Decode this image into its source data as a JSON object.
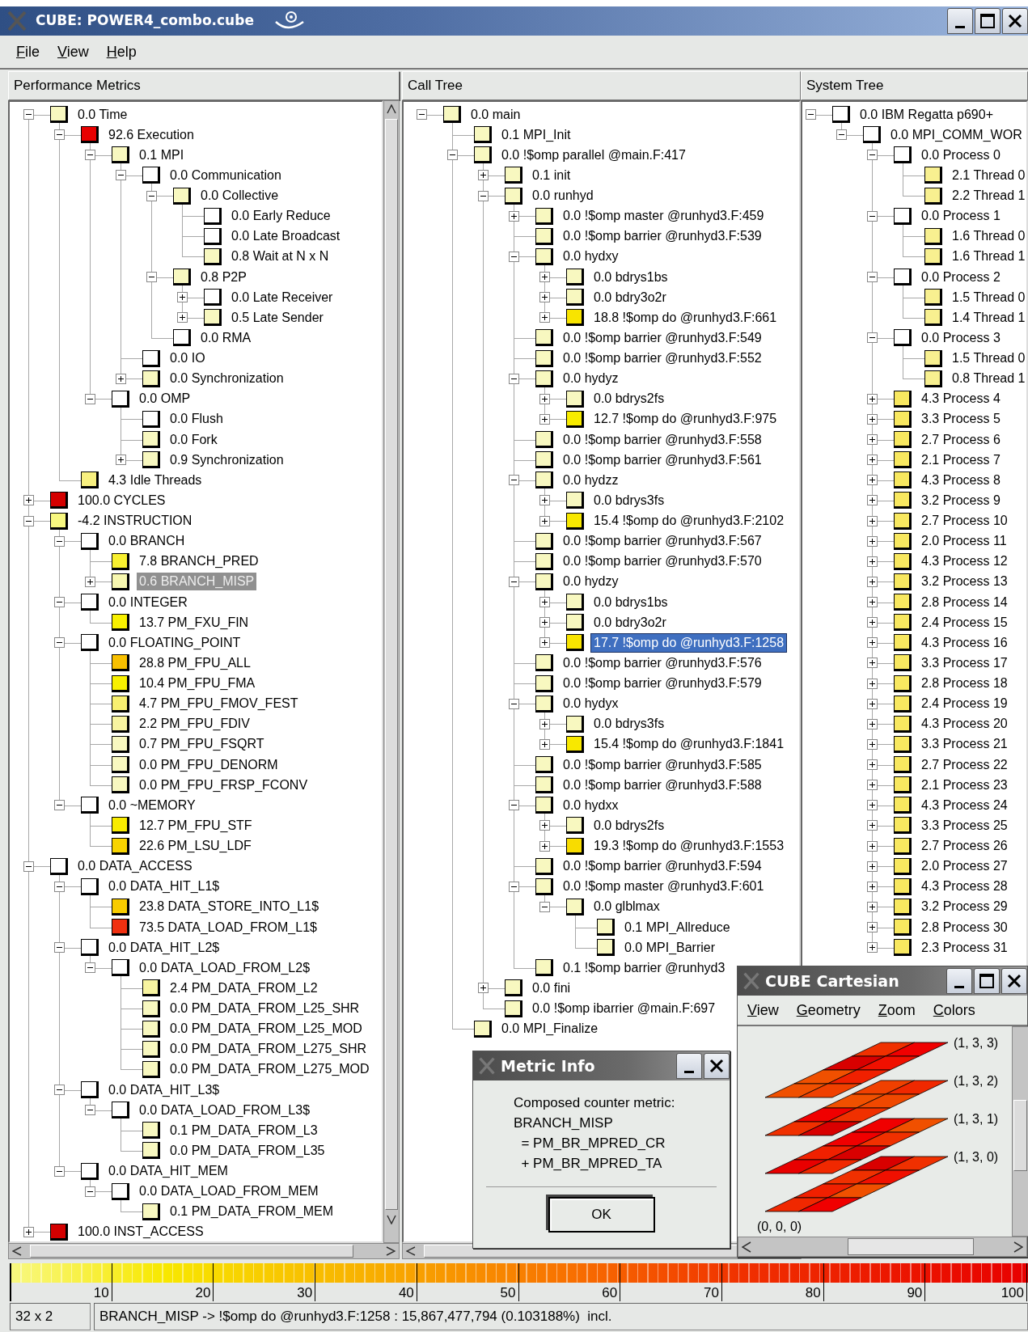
{
  "window": {
    "title": "CUBE: POWER4_combo.cube"
  },
  "menu": [
    "File",
    "View",
    "Help"
  ],
  "panels": [
    {
      "title": "Performance Metrics",
      "tree": [
        {
          "label": "0.0 Time",
          "color": "#f8f8c0",
          "selected": false,
          "expanded": true,
          "children": [
            {
              "label": "92.6 Execution",
              "color": "#e80000",
              "selected": false,
              "expanded": true,
              "children": [
                {
                  "label": "0.1 MPI",
                  "color": "#f8f8c0",
                  "selected": false,
                  "expanded": true,
                  "children": [
                    {
                      "label": "0.0 Communication",
                      "color": "#ffffff",
                      "selected": false,
                      "expanded": true,
                      "children": [
                        {
                          "label": "0.0 Collective",
                          "color": "#f8f8c0",
                          "selected": false,
                          "expanded": true,
                          "children": [
                            {
                              "label": "0.0 Early Reduce",
                              "color": "#ffffff",
                              "selected": false
                            },
                            {
                              "label": "0.0 Late Broadcast",
                              "color": "#ffffff",
                              "selected": false
                            },
                            {
                              "label": "0.8 Wait at N x N",
                              "color": "#f8f8c0",
                              "selected": false
                            }
                          ]
                        },
                        {
                          "label": "0.8 P2P",
                          "color": "#f8f8c0",
                          "selected": false,
                          "expanded": true,
                          "children": [
                            {
                              "label": "0.0 Late Receiver",
                              "color": "#ffffff",
                              "selected": false,
                              "expanded": false
                            },
                            {
                              "label": "0.5 Late Sender",
                              "color": "#f8f8c0",
                              "selected": false,
                              "expanded": false
                            }
                          ]
                        },
                        {
                          "label": "0.0 RMA",
                          "color": "#ffffff",
                          "selected": false
                        }
                      ]
                    },
                    {
                      "label": "0.0 IO",
                      "color": "#ffffff",
                      "selected": false
                    },
                    {
                      "label": "0.0 Synchronization",
                      "color": "#f8f8c0",
                      "selected": false,
                      "expanded": false
                    }
                  ]
                },
                {
                  "label": "0.0 OMP",
                  "color": "#ffffff",
                  "selected": false,
                  "expanded": true,
                  "children": [
                    {
                      "label": "0.0 Flush",
                      "color": "#ffffff",
                      "selected": false
                    },
                    {
                      "label": "0.0 Fork",
                      "color": "#f8f8c0",
                      "selected": false
                    },
                    {
                      "label": "0.9 Synchronization",
                      "color": "#f8f8c0",
                      "selected": false,
                      "expanded": false
                    }
                  ]
                }
              ]
            },
            {
              "label": "4.3 Idle Threads",
              "color": "#f8f080",
              "selected": false
            }
          ]
        },
        {
          "label": "100.0 CYCLES",
          "color": "#d40000",
          "selected": false,
          "expanded": false
        },
        {
          "label": "-4.2 INSTRUCTION",
          "color": "#f8f880",
          "selected": false,
          "expanded": true,
          "children": [
            {
              "label": "0.0 BRANCH",
              "color": "#ffffff",
              "selected": false,
              "expanded": true,
              "children": [
                {
                  "label": "7.8 BRANCH_PRED",
                  "color": "#f8f030",
                  "selected": false
                },
                {
                  "label": "0.6 BRANCH_MISP",
                  "color": "#f8f8b0",
                  "selected": true,
                  "expanded": false
                }
              ]
            },
            {
              "label": "0.0 INTEGER",
              "color": "#ffffff",
              "selected": false,
              "expanded": true,
              "children": [
                {
                  "label": "13.7 PM_FXU_FIN",
                  "color": "#f8f000",
                  "selected": false
                }
              ]
            },
            {
              "label": "0.0 FLOATING_POINT",
              "color": "#ffffff",
              "selected": false,
              "expanded": true,
              "children": [
                {
                  "label": "28.8 PM_FPU_ALL",
                  "color": "#f8c000",
                  "selected": false
                },
                {
                  "label": "10.4 PM_FPU_FMA",
                  "color": "#f8f000",
                  "selected": false
                },
                {
                  "label": "4.7 PM_FPU_FMOV_FEST",
                  "color": "#f8f070",
                  "selected": false
                },
                {
                  "label": "2.2 PM_FPU_FDIV",
                  "color": "#f8f4a0",
                  "selected": false
                },
                {
                  "label": "0.7 PM_FPU_FSQRT",
                  "color": "#f8f8c0",
                  "selected": false
                },
                {
                  "label": "0.0 PM_FPU_DENORM",
                  "color": "#f8f8c0",
                  "selected": false
                },
                {
                  "label": "0.0 PM_FPU_FRSP_FCONV",
                  "color": "#f8f8c0",
                  "selected": false
                }
              ]
            },
            {
              "label": "0.0 ~MEMORY",
              "color": "#ffffff",
              "selected": false,
              "expanded": true,
              "children": [
                {
                  "label": "12.7 PM_FPU_STF",
                  "color": "#f8ec00",
                  "selected": false
                },
                {
                  "label": "22.6 PM_LSU_LDF",
                  "color": "#f8d400",
                  "selected": false
                }
              ]
            }
          ]
        },
        {
          "label": "0.0 DATA_ACCESS",
          "color": "#ffffff",
          "selected": false,
          "expanded": true,
          "children": [
            {
              "label": "0.0 DATA_HIT_L1$",
              "color": "#ffffff",
              "selected": false,
              "expanded": true,
              "children": [
                {
                  "label": "23.8 DATA_STORE_INTO_L1$",
                  "color": "#f8cc00",
                  "selected": false
                },
                {
                  "label": "73.5 DATA_LOAD_FROM_L1$",
                  "color": "#f03010",
                  "selected": false
                }
              ]
            },
            {
              "label": "0.0 DATA_HIT_L2$",
              "color": "#ffffff",
              "selected": false,
              "expanded": true,
              "children": [
                {
                  "label": "0.0 DATA_LOAD_FROM_L2$",
                  "color": "#ffffff",
                  "selected": false,
                  "expanded": true,
                  "children": [
                    {
                      "label": "2.4 PM_DATA_FROM_L2",
                      "color": "#f8f4a0",
                      "selected": false
                    },
                    {
                      "label": "0.0 PM_DATA_FROM_L25_SHR",
                      "color": "#f8f8c0",
                      "selected": false
                    },
                    {
                      "label": "0.0 PM_DATA_FROM_L25_MOD",
                      "color": "#f8f8c0",
                      "selected": false
                    },
                    {
                      "label": "0.0 PM_DATA_FROM_L275_SHR",
                      "color": "#f8f8c0",
                      "selected": false
                    },
                    {
                      "label": "0.0 PM_DATA_FROM_L275_MOD",
                      "color": "#f8f8c0",
                      "selected": false
                    }
                  ]
                }
              ]
            },
            {
              "label": "0.0 DATA_HIT_L3$",
              "color": "#ffffff",
              "selected": false,
              "expanded": true,
              "children": [
                {
                  "label": "0.0 DATA_LOAD_FROM_L3$",
                  "color": "#ffffff",
                  "selected": false,
                  "expanded": true,
                  "children": [
                    {
                      "label": "0.1 PM_DATA_FROM_L3",
                      "color": "#f8f8c0",
                      "selected": false
                    },
                    {
                      "label": "0.0 PM_DATA_FROM_L35",
                      "color": "#f8f8c0",
                      "selected": false
                    }
                  ]
                }
              ]
            },
            {
              "label": "0.0 DATA_HIT_MEM",
              "color": "#ffffff",
              "selected": false,
              "expanded": true,
              "children": [
                {
                  "label": "0.0 DATA_LOAD_FROM_MEM",
                  "color": "#ffffff",
                  "selected": false,
                  "expanded": true,
                  "children": [
                    {
                      "label": "0.1 PM_DATA_FROM_MEM",
                      "color": "#f8f8c0",
                      "selected": false
                    }
                  ]
                }
              ]
            }
          ]
        },
        {
          "label": "100.0 INST_ACCESS",
          "color": "#d40000",
          "selected": false,
          "expanded": false
        }
      ]
    },
    {
      "title": "Call Tree",
      "tree": [
        {
          "label": "0.0 main",
          "color": "#f8f8c0",
          "selected": false,
          "expanded": true,
          "children": [
            {
              "label": "0.1 MPI_Init",
              "color": "#f8f8c0",
              "selected": false
            },
            {
              "label": "0.0 !$omp parallel @main.F:417",
              "color": "#f8f8c0",
              "selected": false,
              "expanded": true,
              "children": [
                {
                  "label": "0.1 init",
                  "color": "#f8f8c0",
                  "selected": false,
                  "expanded": false
                },
                {
                  "label": "0.0 runhyd",
                  "color": "#f8f8c0",
                  "selected": false,
                  "expanded": true,
                  "children": [
                    {
                      "label": "0.0 !$omp master @runhyd3.F:459",
                      "color": "#f8f8c0",
                      "selected": false,
                      "expanded": false
                    },
                    {
                      "label": "0.0 !$omp barrier @runhyd3.F:539",
                      "color": "#f8f8c0",
                      "selected": false
                    },
                    {
                      "label": "0.0 hydxy",
                      "color": "#f8f8c0",
                      "selected": false,
                      "expanded": true,
                      "children": [
                        {
                          "label": "0.0 bdrys1bs",
                          "color": "#f8f8c0",
                          "selected": false,
                          "expanded": false
                        },
                        {
                          "label": "0.0 bdry3o2r",
                          "color": "#f8f8c0",
                          "selected": false,
                          "expanded": false
                        },
                        {
                          "label": "18.8 !$omp do @runhyd3.F:661",
                          "color": "#f8e400",
                          "selected": false,
                          "expanded": false
                        }
                      ]
                    },
                    {
                      "label": "0.0 !$omp barrier @runhyd3.F:549",
                      "color": "#f8f8c0",
                      "selected": false
                    },
                    {
                      "label": "0.0 !$omp barrier @runhyd3.F:552",
                      "color": "#f8f8c0",
                      "selected": false
                    },
                    {
                      "label": "0.0 hydyz",
                      "color": "#f8f8c0",
                      "selected": false,
                      "expanded": true,
                      "children": [
                        {
                          "label": "0.0 bdrys2fs",
                          "color": "#f8f8c0",
                          "selected": false,
                          "expanded": false
                        },
                        {
                          "label": "12.7 !$omp do @runhyd3.F:975",
                          "color": "#f8ec00",
                          "selected": false,
                          "expanded": false
                        }
                      ]
                    },
                    {
                      "label": "0.0 !$omp barrier @runhyd3.F:558",
                      "color": "#f8f8c0",
                      "selected": false
                    },
                    {
                      "label": "0.0 !$omp barrier @runhyd3.F:561",
                      "color": "#f8f8c0",
                      "selected": false
                    },
                    {
                      "label": "0.0 hydzz",
                      "color": "#f8f8c0",
                      "selected": false,
                      "expanded": true,
                      "children": [
                        {
                          "label": "0.0 bdrys3fs",
                          "color": "#f8f8c0",
                          "selected": false,
                          "expanded": false
                        },
                        {
                          "label": "15.4 !$omp do @runhyd3.F:2102",
                          "color": "#f8e800",
                          "selected": false,
                          "expanded": false
                        }
                      ]
                    },
                    {
                      "label": "0.0 !$omp barrier @runhyd3.F:567",
                      "color": "#f8f8c0",
                      "selected": false
                    },
                    {
                      "label": "0.0 !$omp barrier @runhyd3.F:570",
                      "color": "#f8f8c0",
                      "selected": false
                    },
                    {
                      "label": "0.0 hydzy",
                      "color": "#f8f8c0",
                      "selected": false,
                      "expanded": true,
                      "children": [
                        {
                          "label": "0.0 bdrys1bs",
                          "color": "#f8f8c0",
                          "selected": false,
                          "expanded": false
                        },
                        {
                          "label": "0.0 bdry3o2r",
                          "color": "#f8f8c0",
                          "selected": false,
                          "expanded": false
                        },
                        {
                          "label": "17.7 !$omp do @runhyd3.F:1258",
                          "color": "#f8e400",
                          "selected": true,
                          "expanded": false
                        }
                      ]
                    },
                    {
                      "label": "0.0 !$omp barrier @runhyd3.F:576",
                      "color": "#f8f8c0",
                      "selected": false
                    },
                    {
                      "label": "0.0 !$omp barrier @runhyd3.F:579",
                      "color": "#f8f8c0",
                      "selected": false
                    },
                    {
                      "label": "0.0 hydyx",
                      "color": "#f8f8c0",
                      "selected": false,
                      "expanded": true,
                      "children": [
                        {
                          "label": "0.0 bdrys3fs",
                          "color": "#f8f8c0",
                          "selected": false,
                          "expanded": false
                        },
                        {
                          "label": "15.4 !$omp do @runhyd3.F:1841",
                          "color": "#f8e800",
                          "selected": false,
                          "expanded": false
                        }
                      ]
                    },
                    {
                      "label": "0.0 !$omp barrier @runhyd3.F:585",
                      "color": "#f8f8c0",
                      "selected": false
                    },
                    {
                      "label": "0.0 !$omp barrier @runhyd3.F:588",
                      "color": "#f8f8c0",
                      "selected": false
                    },
                    {
                      "label": "0.0 hydxx",
                      "color": "#f8f8c0",
                      "selected": false,
                      "expanded": true,
                      "children": [
                        {
                          "label": "0.0 bdrys2fs",
                          "color": "#f8f8c0",
                          "selected": false,
                          "expanded": false
                        },
                        {
                          "label": "19.3 !$omp do @runhyd3.F:1553",
                          "color": "#f8dc00",
                          "selected": false,
                          "expanded": false
                        }
                      ]
                    },
                    {
                      "label": "0.0 !$omp barrier @runhyd3.F:594",
                      "color": "#f8f8c0",
                      "selected": false
                    },
                    {
                      "label": "0.0 !$omp master @runhyd3.F:601",
                      "color": "#f8f8c0",
                      "selected": false,
                      "expanded": true,
                      "children": [
                        {
                          "label": "0.0 glblmax",
                          "color": "#f8f8c0",
                          "selected": false,
                          "expanded": true,
                          "children": [
                            {
                              "label": "0.1 MPI_Allreduce",
                              "color": "#f8f8c0",
                              "selected": false
                            },
                            {
                              "label": "0.0 MPI_Barrier",
                              "color": "#f8f8c0",
                              "selected": false
                            }
                          ]
                        }
                      ]
                    },
                    {
                      "label": "0.1 !$omp barrier @runhyd3",
                      "color": "#f8f8c0",
                      "selected": false
                    }
                  ]
                },
                {
                  "label": "0.0 fini",
                  "color": "#f8f8c0",
                  "selected": false,
                  "expanded": false
                },
                {
                  "label": "0.0 !$omp ibarrier @main.F:697",
                  "color": "#f8f8c0",
                  "selected": false
                }
              ]
            },
            {
              "label": "0.0 MPI_Finalize",
              "color": "#f8f8c0",
              "selected": false
            }
          ]
        }
      ]
    },
    {
      "title": "System Tree",
      "tree": [
        {
          "label": "0.0 IBM Regatta p690+",
          "color": "#ffffff",
          "selected": false,
          "expanded": true,
          "children": [
            {
              "label": "0.0 MPI_COMM_WOR",
              "color": "#ffffff",
              "selected": false,
              "expanded": true,
              "children": [
                {
                  "label": "0.0 Process 0",
                  "color": "#ffffff",
                  "selected": false,
                  "expanded": true,
                  "children": [
                    {
                      "label": "2.1 Thread 0",
                      "color": "#f8f090",
                      "selected": false
                    },
                    {
                      "label": "2.2 Thread 1",
                      "color": "#f8f090",
                      "selected": false
                    }
                  ]
                },
                {
                  "label": "0.0 Process 1",
                  "color": "#ffffff",
                  "selected": false,
                  "expanded": true,
                  "children": [
                    {
                      "label": "1.6 Thread 0",
                      "color": "#f8f090",
                      "selected": false
                    },
                    {
                      "label": "1.6 Thread 1",
                      "color": "#f8f090",
                      "selected": false
                    }
                  ]
                },
                {
                  "label": "0.0 Process 2",
                  "color": "#ffffff",
                  "selected": false,
                  "expanded": true,
                  "children": [
                    {
                      "label": "1.5 Thread 0",
                      "color": "#f8f090",
                      "selected": false
                    },
                    {
                      "label": "1.4 Thread 1",
                      "color": "#f8f090",
                      "selected": false
                    }
                  ]
                },
                {
                  "label": "0.0 Process 3",
                  "color": "#ffffff",
                  "selected": false,
                  "expanded": true,
                  "children": [
                    {
                      "label": "1.5 Thread 0",
                      "color": "#f8f090",
                      "selected": false
                    },
                    {
                      "label": "0.8 Thread 1",
                      "color": "#f8f090",
                      "selected": false
                    }
                  ]
                },
                {
                  "label": "4.3 Process 4",
                  "color": "#f8e860",
                  "selected": false,
                  "expanded": false
                },
                {
                  "label": "3.3 Process 5",
                  "color": "#f8e860",
                  "selected": false,
                  "expanded": false
                },
                {
                  "label": "2.7 Process 6",
                  "color": "#f8e860",
                  "selected": false,
                  "expanded": false
                },
                {
                  "label": "2.1 Process 7",
                  "color": "#f8e860",
                  "selected": false,
                  "expanded": false
                },
                {
                  "label": "4.3 Process 8",
                  "color": "#f8e860",
                  "selected": false,
                  "expanded": false
                },
                {
                  "label": "3.2 Process 9",
                  "color": "#f8e860",
                  "selected": false,
                  "expanded": false
                },
                {
                  "label": "2.7 Process 10",
                  "color": "#f8e860",
                  "selected": false,
                  "expanded": false
                },
                {
                  "label": "2.0 Process 11",
                  "color": "#f8e860",
                  "selected": false,
                  "expanded": false
                },
                {
                  "label": "4.3 Process 12",
                  "color": "#f8e860",
                  "selected": false,
                  "expanded": false
                },
                {
                  "label": "3.2 Process 13",
                  "color": "#f8e860",
                  "selected": false,
                  "expanded": false
                },
                {
                  "label": "2.8 Process 14",
                  "color": "#f8e860",
                  "selected": false,
                  "expanded": false
                },
                {
                  "label": "2.4 Process 15",
                  "color": "#f8e860",
                  "selected": false,
                  "expanded": false
                },
                {
                  "label": "4.3 Process 16",
                  "color": "#f8e860",
                  "selected": false,
                  "expanded": false
                },
                {
                  "label": "3.3 Process 17",
                  "color": "#f8e860",
                  "selected": false,
                  "expanded": false
                },
                {
                  "label": "2.8 Process 18",
                  "color": "#f8e860",
                  "selected": false,
                  "expanded": false
                },
                {
                  "label": "2.4 Process 19",
                  "color": "#f8e860",
                  "selected": false,
                  "expanded": false
                },
                {
                  "label": "4.3 Process 20",
                  "color": "#f8e860",
                  "selected": false,
                  "expanded": false
                },
                {
                  "label": "3.3 Process 21",
                  "color": "#f8e860",
                  "selected": false,
                  "expanded": false
                },
                {
                  "label": "2.7 Process 22",
                  "color": "#f8e860",
                  "selected": false,
                  "expanded": false
                },
                {
                  "label": "2.1 Process 23",
                  "color": "#f8e860",
                  "selected": false,
                  "expanded": false
                },
                {
                  "label": "4.3 Process 24",
                  "color": "#f8e860",
                  "selected": false,
                  "expanded": false
                },
                {
                  "label": "3.3 Process 25",
                  "color": "#f8e860",
                  "selected": false,
                  "expanded": false
                },
                {
                  "label": "2.7 Process 26",
                  "color": "#f8e860",
                  "selected": false,
                  "expanded": false
                },
                {
                  "label": "2.0 Process 27",
                  "color": "#f8e860",
                  "selected": false,
                  "expanded": false
                },
                {
                  "label": "4.3 Process 28",
                  "color": "#f8e860",
                  "selected": false,
                  "expanded": false
                },
                {
                  "label": "3.2 Process 29",
                  "color": "#f8e860",
                  "selected": false,
                  "expanded": false
                },
                {
                  "label": "2.8 Process 30",
                  "color": "#f8e860",
                  "selected": false,
                  "expanded": false
                },
                {
                  "label": "2.3 Process 31",
                  "color": "#f8e860",
                  "selected": false,
                  "expanded": false
                }
              ]
            }
          ]
        }
      ]
    }
  ],
  "color_scale": {
    "ticks": [
      "10",
      "20",
      "30",
      "40",
      "50",
      "60",
      "70",
      "80",
      "90",
      "100"
    ]
  },
  "status_bar": {
    "size": "32 x 2",
    "message": "BRANCH_MISP -> !$omp do @runhyd3.F:1258 : 15,867,477,794 (0.103188%)  incl."
  },
  "metric_info": {
    "title": "Metric Info",
    "lines": [
      "Composed counter metric:",
      "BRANCH_MISP",
      "  = PM_BR_MPRED_CR",
      "  + PM_BR_MPRED_TA"
    ],
    "button": "OK"
  },
  "cartesian": {
    "title": "CUBE Cartesian",
    "menu": [
      "View",
      "Geometry",
      "Zoom",
      "Colors"
    ],
    "origin_label": "(0, 0, 0)",
    "planes": [
      {
        "label": "(1, 3, 3)",
        "cells": [
          {
            "color": "#f03000"
          },
          {
            "color": "#f00000"
          },
          {
            "color": "#d80000"
          },
          {
            "color": "#f01000"
          },
          {
            "color": "#f05000"
          },
          {
            "color": "#f02000"
          },
          {
            "color": "#f05000"
          },
          {
            "color": "#f04000"
          }
        ]
      },
      {
        "label": "(1, 3, 2)",
        "cells": [
          {
            "color": "#f04000"
          },
          {
            "color": "#f02800"
          },
          {
            "color": "#f05000"
          },
          {
            "color": "#f04800"
          },
          {
            "color": "#f00000"
          },
          {
            "color": "#f03000"
          },
          {
            "color": "#f03000"
          },
          {
            "color": "#d80000"
          }
        ]
      },
      {
        "label": "(1, 3, 1)",
        "cells": [
          {
            "color": "#f00000"
          },
          {
            "color": "#f05000"
          },
          {
            "color": "#f00000"
          },
          {
            "color": "#f03000"
          },
          {
            "color": "#f02000"
          },
          {
            "color": "#d80000"
          },
          {
            "color": "#e80000"
          },
          {
            "color": "#f02800"
          }
        ]
      },
      {
        "label": "(1, 3, 0)",
        "cells": [
          {
            "color": "#d80000"
          },
          {
            "color": "#f03000"
          },
          {
            "color": "#f03000"
          },
          {
            "color": "#f01000"
          },
          {
            "color": "#f02000"
          },
          {
            "color": "#f05000"
          },
          {
            "color": "#f02800"
          },
          {
            "color": "#f00000"
          }
        ]
      }
    ]
  }
}
